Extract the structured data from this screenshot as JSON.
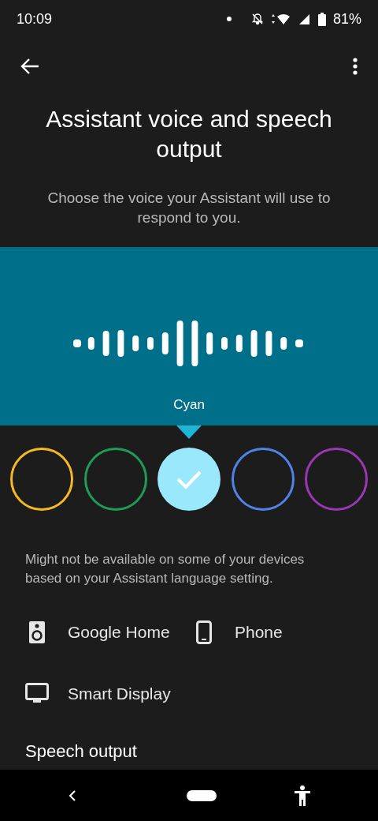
{
  "status_bar": {
    "time": "10:09",
    "battery": "81%"
  },
  "title": "Assistant voice and speech output",
  "subtitle": "Choose the voice your Assistant will use to respond to you.",
  "voice_name": "Cyan",
  "voices": [
    {
      "color": "#f6b91f",
      "selected": false
    },
    {
      "color": "#1e9c57",
      "selected": false
    },
    {
      "color": "#9ae8fb",
      "selected": true
    },
    {
      "color": "#4f83e8",
      "selected": false
    },
    {
      "color": "#9a37b5",
      "selected": false
    }
  ],
  "note": "Might not be available on some of your devices based on your Assistant language setting.",
  "devices": [
    {
      "kind": "speaker",
      "label": "Google Home"
    },
    {
      "kind": "phone",
      "label": "Phone"
    },
    {
      "kind": "display",
      "label": "Smart Display"
    }
  ],
  "section_heading": "Speech output"
}
